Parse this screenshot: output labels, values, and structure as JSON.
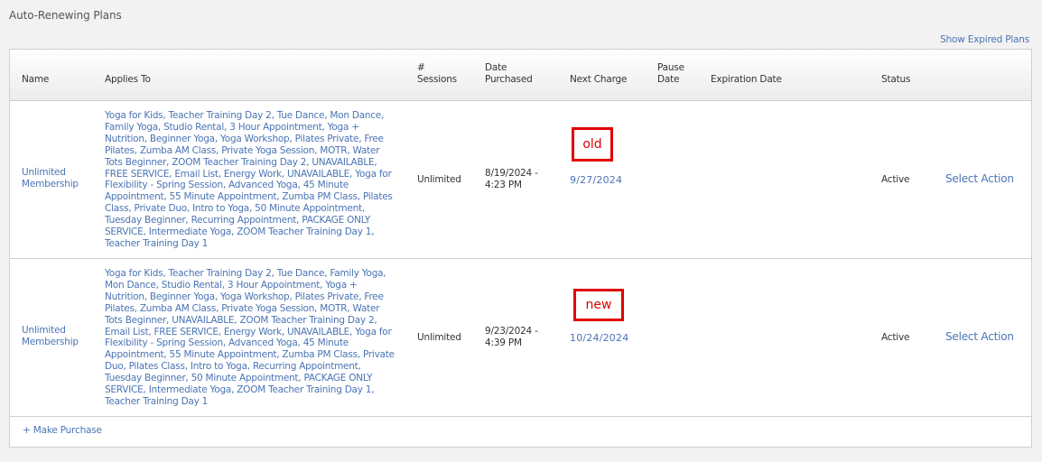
{
  "section": {
    "title": "Auto-Renewing Plans",
    "show_expired_label": "Show Expired Plans"
  },
  "table": {
    "headers": {
      "name": "Name",
      "applies_to": "Applies To",
      "sessions_line1": "#",
      "sessions_line2": "Sessions",
      "date_purchased_line1": "Date",
      "date_purchased_line2": "Purchased",
      "next_charge": "Next Charge",
      "pause_date_line1": "Pause",
      "pause_date_line2": "Date",
      "expiration_date": "Expiration Date",
      "status": "Status"
    },
    "rows": [
      {
        "name": "Unlimited Membership",
        "applies_to": "Yoga for Kids, Teacher Training Day 2, Tue Dance, Mon Dance, Family Yoga, Studio Rental, 3 Hour Appointment, Yoga + Nutrition, Beginner Yoga, Yoga Workshop, Pilates Private, Free Pilates, Zumba AM Class, Private Yoga Session, MOTR, Water Tots Beginner, ZOOM Teacher Training Day 2, UNAVAILABLE, FREE SERVICE, Email List, Energy Work, UNAVAILABLE, Yoga for Flexibility - Spring Session, Advanced Yoga, 45 Minute Appointment, 55 Minute Appointment, Zumba PM Class, Pilates Class, Private Duo, Intro to Yoga, 50 Minute Appointment, Tuesday Beginner, Recurring Appointment, PACKAGE ONLY SERVICE, Intermediate Yoga, ZOOM Teacher Training Day 1, Teacher Training Day 1",
        "sessions": "Unlimited",
        "date_purchased": "8/19/2024 - 4:23 PM",
        "next_charge": "9/27/2024",
        "pause_date": "",
        "expiration_date": "",
        "status": "Active",
        "action_label": "Select Action",
        "annotation": "old"
      },
      {
        "name": "Unlimited Membership",
        "applies_to": "Yoga for Kids, Teacher Training Day 2, Tue Dance, Family Yoga, Mon Dance, Studio Rental, 3 Hour Appointment, Yoga + Nutrition, Beginner Yoga, Yoga Workshop, Pilates Private, Free Pilates, Zumba AM Class, Private Yoga Session, MOTR, Water Tots Beginner, UNAVAILABLE, ZOOM Teacher Training Day 2, Email List, FREE SERVICE, Energy Work, UNAVAILABLE, Yoga for Flexibility - Spring Session, Advanced Yoga, 45 Minute Appointment, 55 Minute Appointment, Zumba PM Class, Private Duo, Pilates Class, Intro to Yoga, Recurring Appointment, Tuesday Beginner, 50 Minute Appointment, PACKAGE ONLY SERVICE, Intermediate Yoga, ZOOM Teacher Training Day 1, Teacher Training Day 1",
        "sessions": "Unlimited",
        "date_purchased": "9/23/2024 - 4:39 PM",
        "next_charge": "10/24/2024",
        "pause_date": "",
        "expiration_date": "",
        "status": "Active",
        "action_label": "Select Action",
        "annotation": "new"
      }
    ],
    "make_purchase_label": "+ Make Purchase"
  },
  "colors": {
    "link": "#4a74b5",
    "annotation_red": "#e00000",
    "header_gradient_end": "#ececec",
    "border": "#cfcfcf"
  }
}
